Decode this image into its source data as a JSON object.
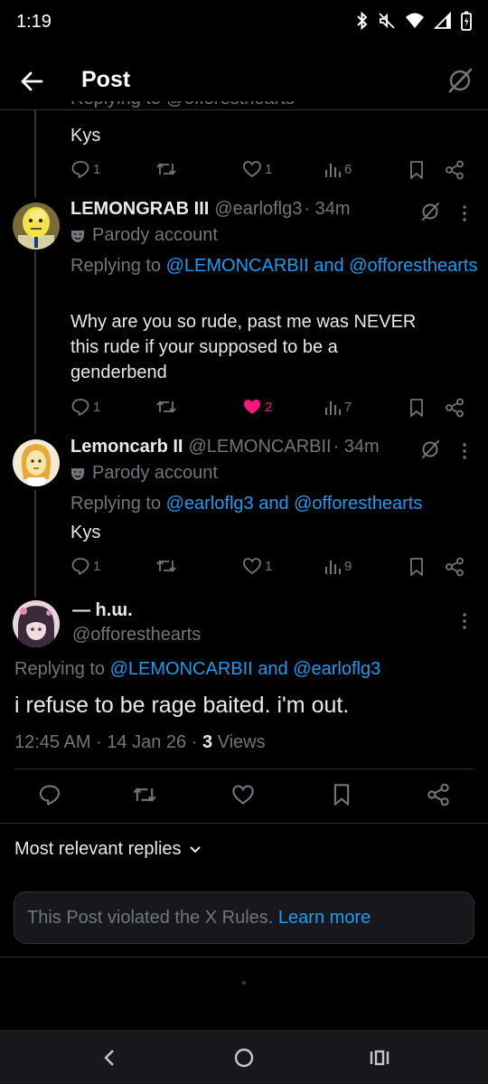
{
  "status_bar": {
    "time": "1:19"
  },
  "header": {
    "title": "Post"
  },
  "cutoff_reply": {
    "replying_text": "Replying to @offoresthearts",
    "text": "Kys",
    "stats": {
      "replies": "1",
      "likes": "1",
      "views": "6"
    }
  },
  "reply1": {
    "name": "LEMONGRAB III",
    "handle": "@earloflg3",
    "time": "· 34m",
    "parody_label": "Parody account",
    "replying_prefix": "Replying to",
    "replying_handles": "@LEMONCARBII and @offoresthearts",
    "text_line1": "Why are you so rude, past me was NEVER",
    "text_line2": "this rude if your supposed to be a",
    "text_line3": "genderbend",
    "stats": {
      "replies": "1",
      "likes": "2",
      "views": "7"
    }
  },
  "reply2": {
    "name": "Lemoncarb II",
    "handle": "@LEMONCARBII",
    "time": "· 34m",
    "parody_label": "Parody account",
    "replying_prefix": "Replying to",
    "replying_handles": "@earloflg3 and @offoresthearts",
    "text": "Kys",
    "stats": {
      "replies": "1",
      "likes": "1",
      "views": "9"
    }
  },
  "main_post": {
    "name": "— h.ɯ.",
    "handle": "@offoresthearts",
    "replying_prefix": "Replying to",
    "replying_handles": "@LEMONCARBII and @earloflg3",
    "text": "i refuse to be rage baited. i'm out.",
    "time": "12:45 AM",
    "date": "14 Jan 26",
    "views_count": "3",
    "views_label": "Views"
  },
  "replies_section": {
    "sort_label": "Most relevant replies",
    "violation_text": "This Post violated the X Rules.",
    "learn_more": "Learn more"
  },
  "colors": {
    "background": "#000000",
    "accent": "#1d9bf0",
    "muted": "#71767b",
    "like": "#f91880",
    "divider": "#2f3336"
  },
  "icons": [
    "back-arrow-icon",
    "grok-icon",
    "reply-icon",
    "repost-icon",
    "like-icon",
    "views-icon",
    "bookmark-icon",
    "share-icon",
    "more-icon",
    "parody-mask-icon",
    "chevron-down-icon",
    "bluetooth-icon",
    "mute-icon",
    "wifi-icon",
    "signal-icon",
    "battery-icon"
  ]
}
